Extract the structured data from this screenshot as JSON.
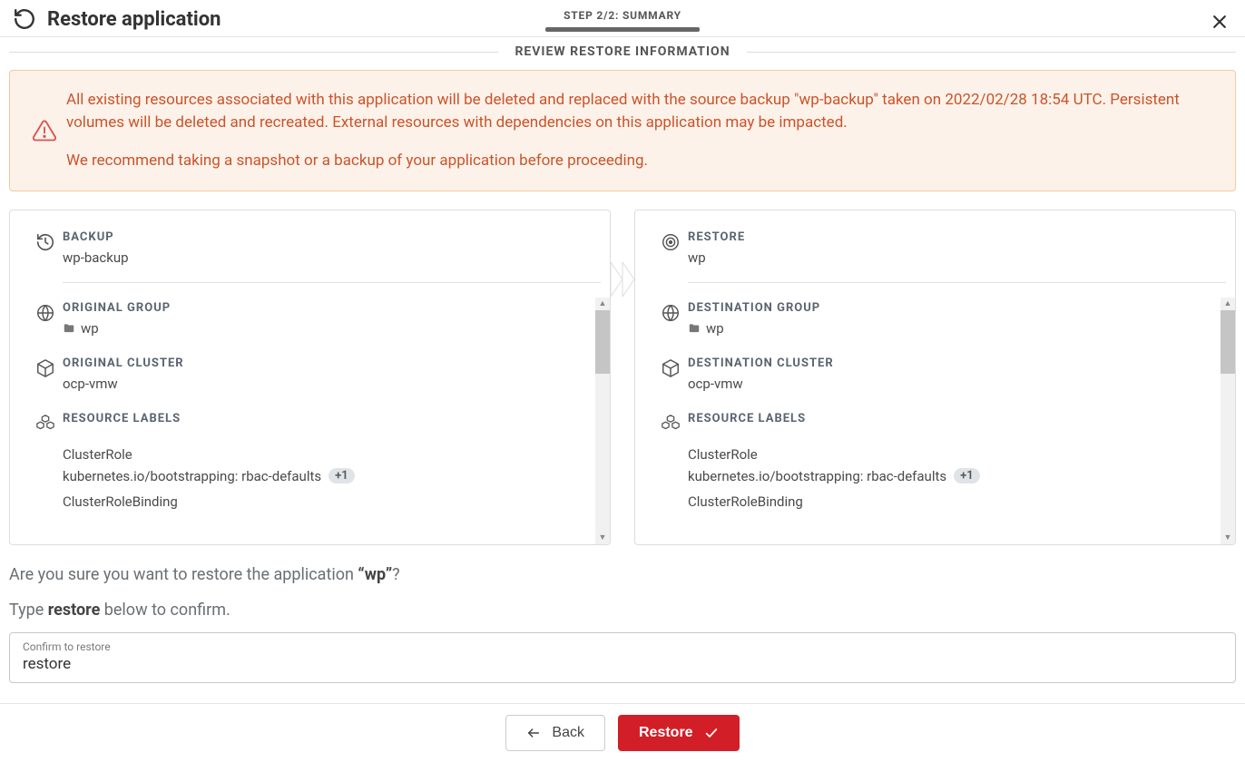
{
  "header": {
    "title": "Restore application",
    "step_text": "STEP 2/2: SUMMARY"
  },
  "section_title": "REVIEW RESTORE INFORMATION",
  "alert": {
    "line1": "All existing resources associated with this application will be deleted and replaced with the source backup \"wp-backup\" taken on 2022/02/28 18:54 UTC. Persistent volumes will be deleted and recreated. External resources with dependencies on this application may be impacted.",
    "line2": "We recommend taking a snapshot or a backup of your application before proceeding."
  },
  "backup_panel": {
    "backup_label": "BACKUP",
    "backup_value": "wp-backup",
    "group_label": "ORIGINAL GROUP",
    "group_value": "wp",
    "cluster_label": "ORIGINAL CLUSTER",
    "cluster_value": "ocp-vmw",
    "resource_label": "RESOURCE LABELS",
    "resource1_title": "ClusterRole",
    "resource1_detail": "kubernetes.io/bootstrapping: rbac-defaults",
    "resource1_badge": "+1",
    "resource2_title": "ClusterRoleBinding"
  },
  "restore_panel": {
    "restore_label": "RESTORE",
    "restore_value": "wp",
    "group_label": "DESTINATION GROUP",
    "group_value": "wp",
    "cluster_label": "DESTINATION CLUSTER",
    "cluster_value": "ocp-vmw",
    "resource_label": "RESOURCE LABELS",
    "resource1_title": "ClusterRole",
    "resource1_detail": "kubernetes.io/bootstrapping: rbac-defaults",
    "resource1_badge": "+1",
    "resource2_title": "ClusterRoleBinding"
  },
  "confirm": {
    "question_pre": "Are you sure you want to restore the application ",
    "question_app": "“wp”",
    "question_post": "?",
    "instr_pre": "Type ",
    "instr_word": "restore",
    "instr_post": " below to confirm.",
    "input_label": "Confirm to restore",
    "input_value": "restore"
  },
  "footer": {
    "back": "Back",
    "restore": "Restore"
  }
}
